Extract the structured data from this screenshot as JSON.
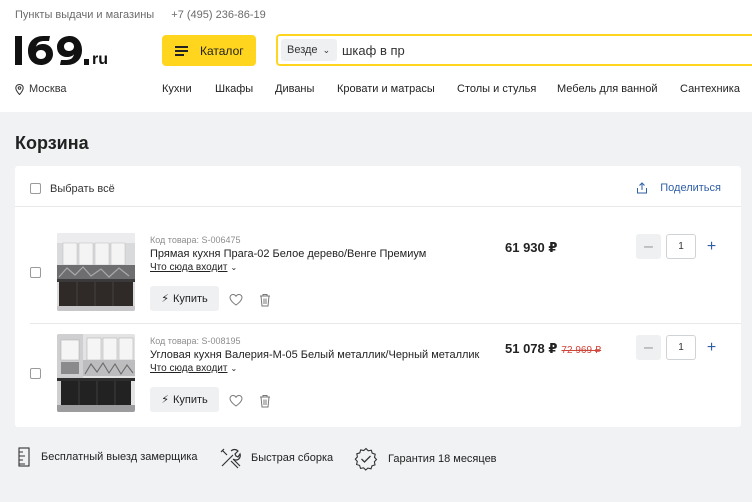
{
  "header": {
    "pickup_link": "Пункты выдачи и магазины",
    "phone": "+7 (495) 236-86-19",
    "logo_text": "169.ru",
    "catalog_label": "Каталог",
    "search": {
      "scope": "Везде",
      "value": "шкаф в пр"
    },
    "city": "Москва",
    "nav": [
      "Кухни",
      "Шкафы",
      "Диваны",
      "Кровати и матрасы",
      "Столы и стулья",
      "Мебель для ванной",
      "Сантехника"
    ]
  },
  "cart": {
    "title": "Корзина",
    "select_all": "Выбрать всё",
    "share": "Поделиться",
    "items": [
      {
        "sku": "Код товара: S-006475",
        "name": "Прямая кухня Прага-02 Белое дерево/Венге Премиум",
        "included": "Что сюда входит",
        "buy_label": "Купить",
        "price": "61 930 ₽",
        "old_price": "",
        "quantity": "1"
      },
      {
        "sku": "Код товара: S-008195",
        "name": "Угловая кухня Валерия-М-05 Белый металлик/Черный металлик",
        "included": "Что сюда входит",
        "buy_label": "Купить",
        "price": "51 078 ₽",
        "old_price": "72 969 ₽",
        "quantity": "1"
      }
    ]
  },
  "benefits": [
    "Бесплатный выезд замерщика",
    "Быстрая сборка",
    "Гарантия 18 месяцев"
  ],
  "colors": {
    "accent_yellow": "#ffd51e",
    "link_blue": "#2f5fa7",
    "old_price_red": "#d0453a",
    "page_bg": "#f0f2f4"
  },
  "icons": [
    "location-icon",
    "chevron-down-icon",
    "share-icon",
    "heart-icon",
    "trash-icon",
    "bolt-icon",
    "ruler-icon",
    "tools-icon",
    "badge-icon"
  ]
}
